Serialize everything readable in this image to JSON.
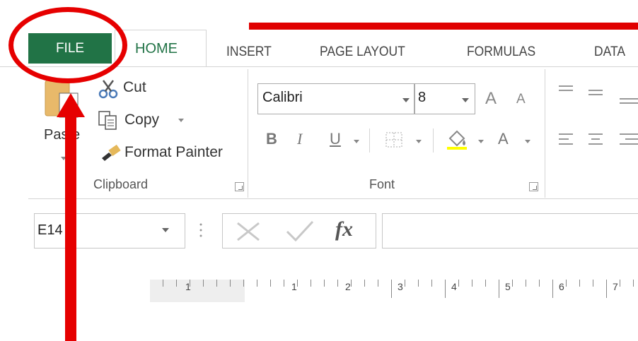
{
  "ribbon": {
    "tabs": {
      "file": "FILE",
      "home": "HOME",
      "insert": "INSERT",
      "page_layout": "PAGE LAYOUT",
      "formulas": "FORMULAS",
      "data": "DATA"
    },
    "active_tab": "HOME",
    "accent_color": "#217346"
  },
  "clipboard": {
    "paste_label": "Paste",
    "cut_label": "Cut",
    "copy_label": "Copy",
    "format_painter_label": "Format Painter",
    "group_label": "Clipboard"
  },
  "font": {
    "font_name": "Calibri",
    "font_size": "8",
    "bold": "B",
    "italic": "I",
    "underline": "U",
    "font_color": "A",
    "grow": "A",
    "shrink": "A",
    "group_label": "Font"
  },
  "formula_bar": {
    "name_box_value": "E14",
    "formula_value": "",
    "fx_label": "fx"
  },
  "ruler": {
    "labels": [
      "1",
      "1",
      "2",
      "3",
      "4",
      "5",
      "6",
      "7"
    ]
  },
  "annotation": {
    "color": "#e60000"
  }
}
